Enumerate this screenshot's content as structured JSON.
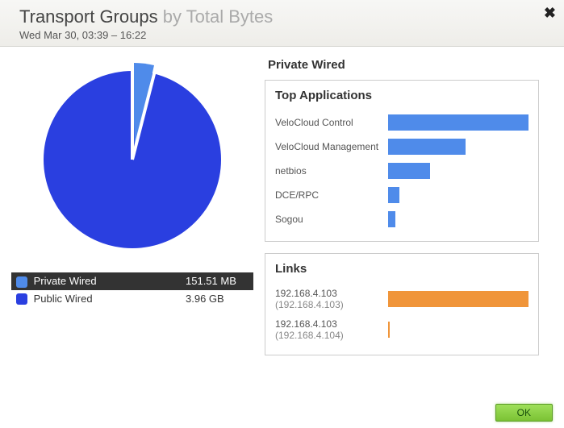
{
  "header": {
    "title_main": "Transport Groups",
    "title_sub": "by Total Bytes",
    "subtitle": "Wed Mar 30, 03:39 – 16:22"
  },
  "chart_data": {
    "type": "pie",
    "title": "Transport Groups by Total Bytes",
    "series": [
      {
        "name": "Private Wired",
        "label": "151.51 MB",
        "value_mb": 151.51,
        "color": "#2a3fe0"
      },
      {
        "name": "Public Wired",
        "label": "3.96 GB",
        "value_mb": 4055,
        "color": "#4f8bea"
      }
    ],
    "selected": "Private Wired"
  },
  "detail": {
    "panel_title": "Private Wired",
    "top_apps": {
      "title": "Top Applications",
      "bar_color": "#4f8bea",
      "items": [
        {
          "name": "VeloCloud Control",
          "pct": 100
        },
        {
          "name": "VeloCloud Management",
          "pct": 55
        },
        {
          "name": "netbios",
          "pct": 30
        },
        {
          "name": "DCE/RPC",
          "pct": 8
        },
        {
          "name": "Sogou",
          "pct": 5
        }
      ]
    },
    "links": {
      "title": "Links",
      "bar_color": "#f0953a",
      "items": [
        {
          "name": "192.168.4.103",
          "sub": "(192.168.4.103)",
          "pct": 100
        },
        {
          "name": "192.168.4.103",
          "sub": "(192.168.4.104)",
          "pct": 1
        }
      ]
    }
  },
  "footer": {
    "ok": "OK"
  },
  "icons": {
    "close": "✖"
  }
}
